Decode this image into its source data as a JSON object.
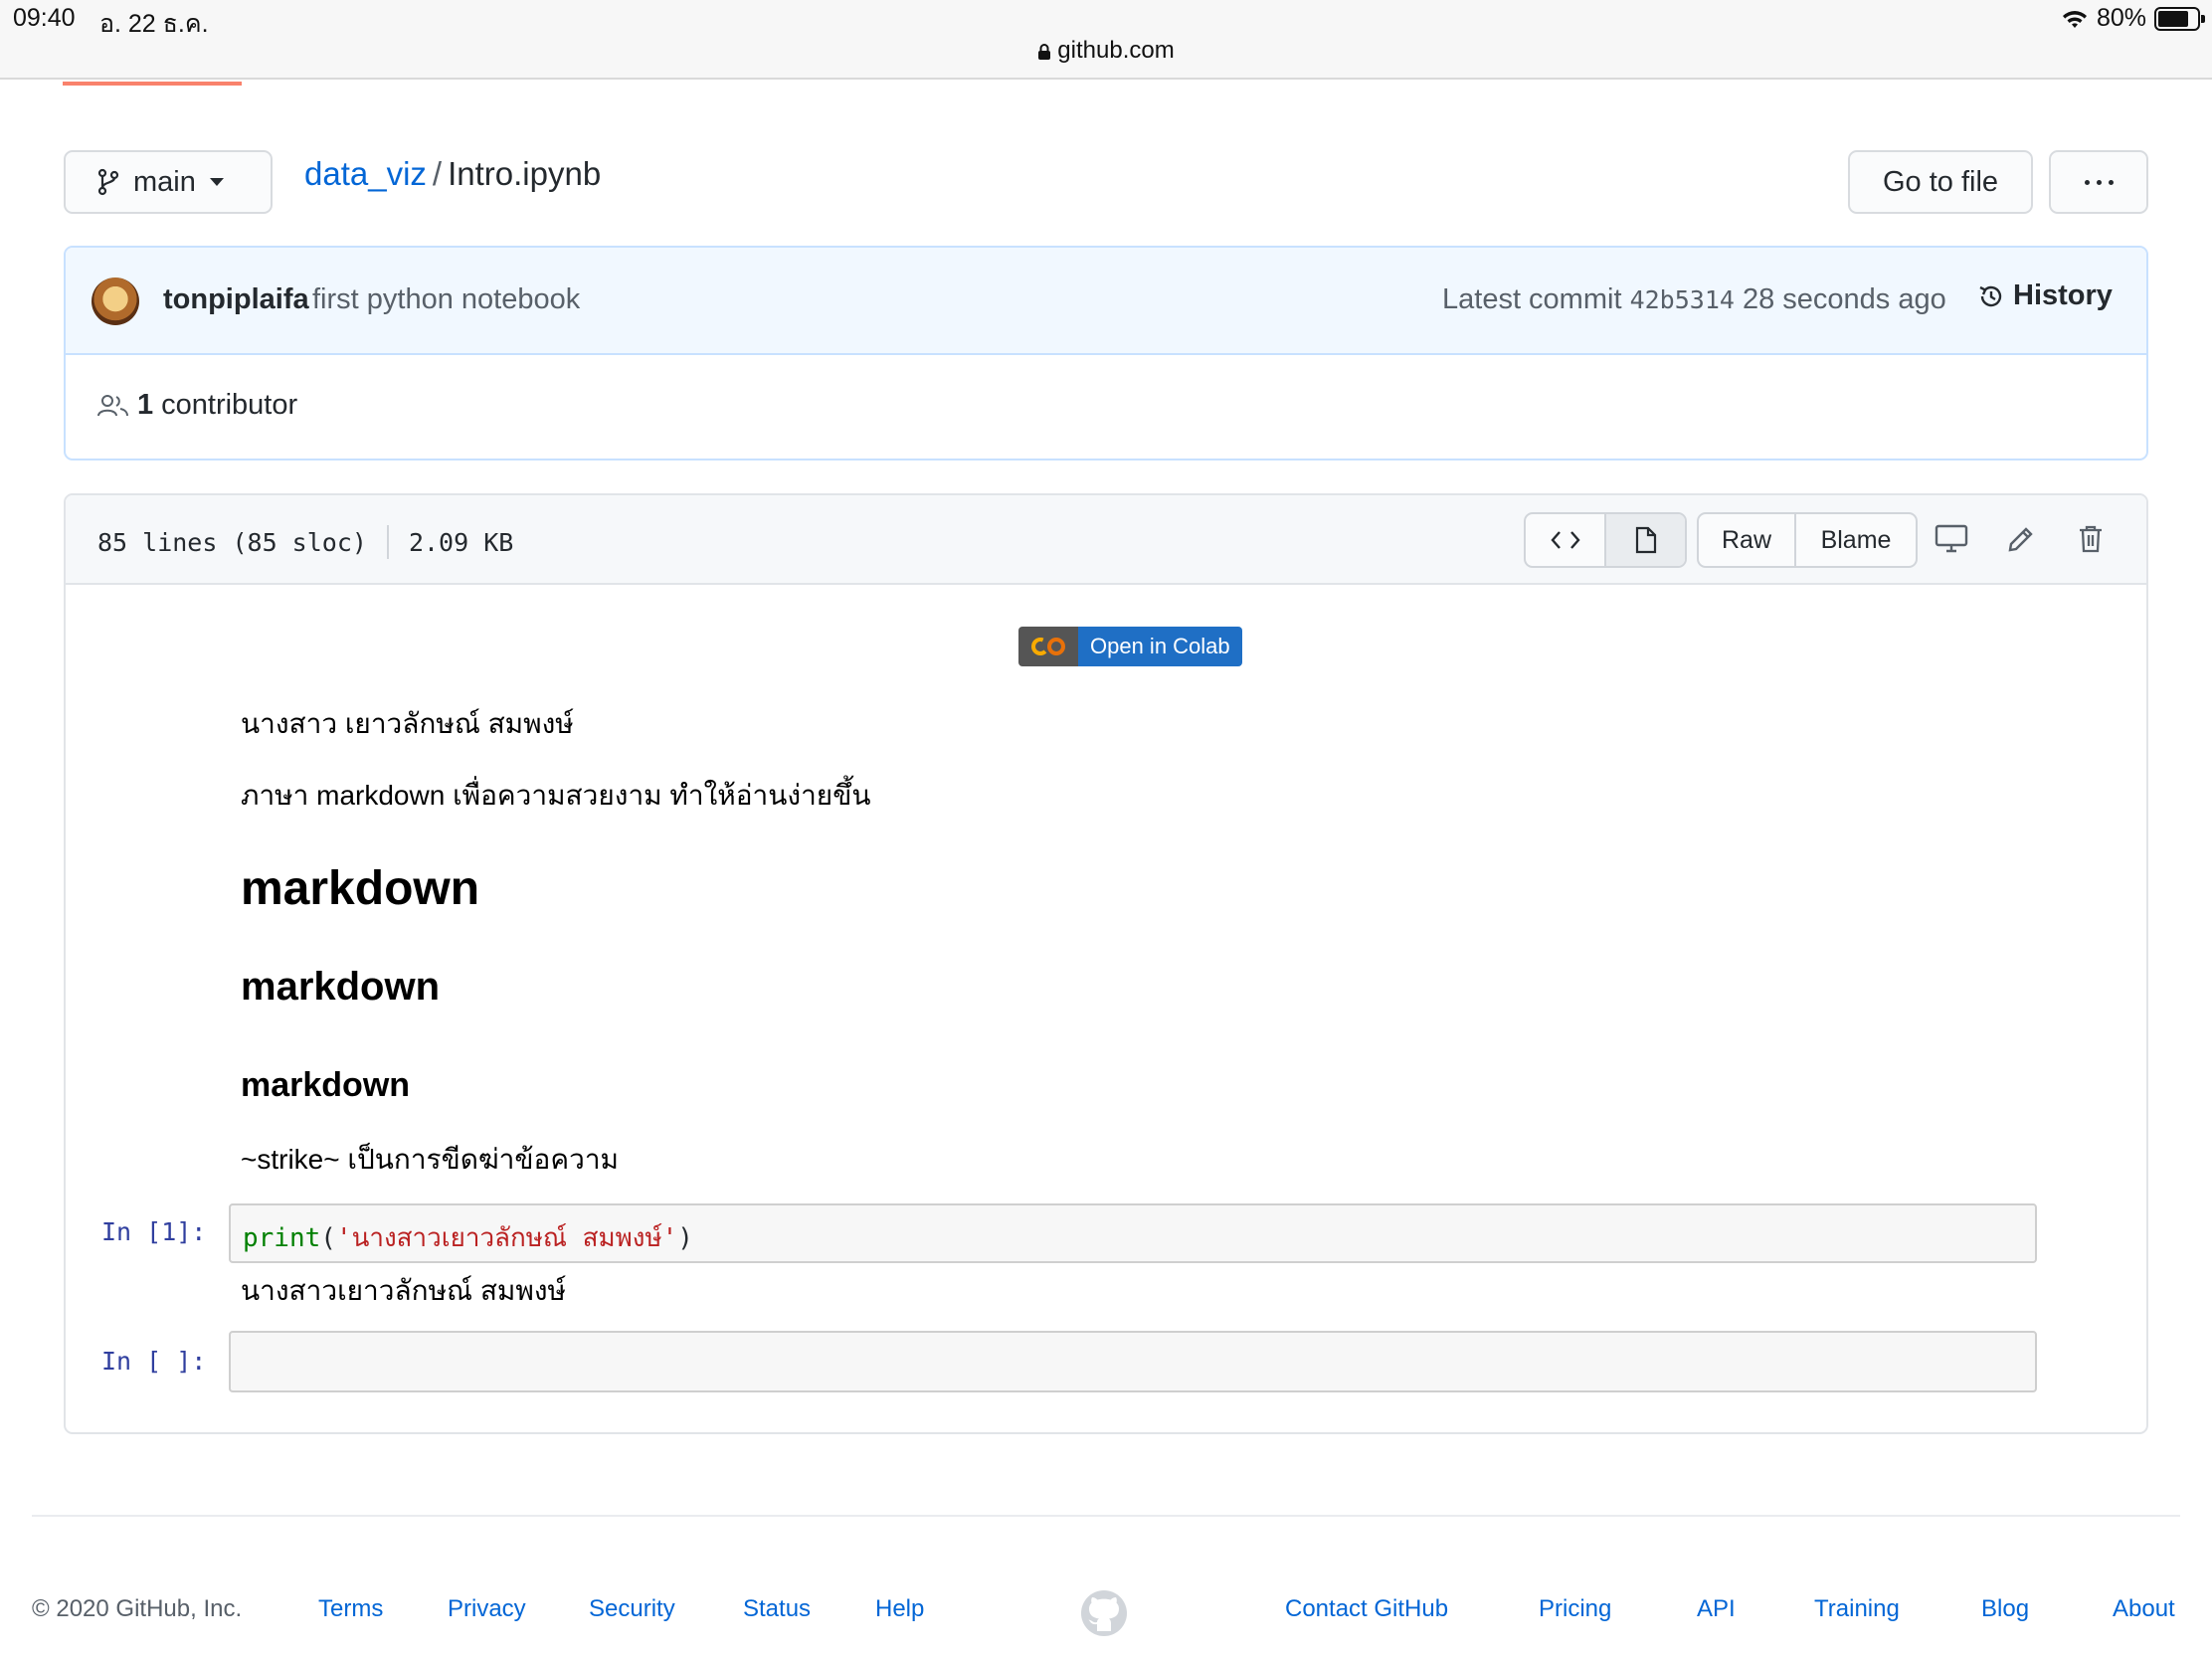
{
  "status_bar": {
    "time": "09:40",
    "date": "อ. 22 ธ.ค.",
    "battery": "80%",
    "battery_level": 0.8,
    "url": "github.com"
  },
  "repo_header": {
    "branch": "main",
    "repo": "data_viz",
    "separator": "/",
    "file": "Intro.ipynb",
    "go_to_file": "Go to file"
  },
  "commit": {
    "author": "tonpiplaifa",
    "message": "first python notebook",
    "latest_label": "Latest commit",
    "sha": "42b5314",
    "time_ago": "28 seconds ago",
    "history": "History",
    "contributors_count": "1",
    "contributors_label": "contributor"
  },
  "file": {
    "lines": "85 lines (85 sloc)",
    "size": "2.09 KB",
    "raw": "Raw",
    "blame": "Blame"
  },
  "notebook": {
    "colab_badge": "Open in Colab",
    "paragraph1": "นางสาว เยาวลักษณ์ สมพงษ์",
    "paragraph2": "ภาษา markdown เพื่อความสวยงาม ทำให้อ่านง่ายขึ้น",
    "heading1": "markdown",
    "heading2": "markdown",
    "heading3": "markdown",
    "paragraph3": "~strike~ เป็นการขีดฆ่าข้อความ",
    "cell1": {
      "prompt": "In [1]:",
      "code_fn": "print",
      "code_open": "(",
      "code_str": "'นางสาวเยาวลักษณ์ สมพงษ์'",
      "code_close": ")",
      "output": "นางสาวเยาวลักษณ์ สมพงษ์"
    },
    "cell2": {
      "prompt": "In [ ]:"
    }
  },
  "footer": {
    "copyright": "© 2020 GitHub, Inc.",
    "links_left": [
      "Terms",
      "Privacy",
      "Security",
      "Status",
      "Help"
    ],
    "links_right": [
      "Contact GitHub",
      "Pricing",
      "API",
      "Training",
      "Blog",
      "About"
    ]
  },
  "colors": {
    "link": "#0366d6",
    "commit_bg": "#f1f8ff",
    "progress": "#f9826c",
    "prompt": "#303f9f",
    "code_keyword": "#008000",
    "code_string": "#ba2121"
  }
}
